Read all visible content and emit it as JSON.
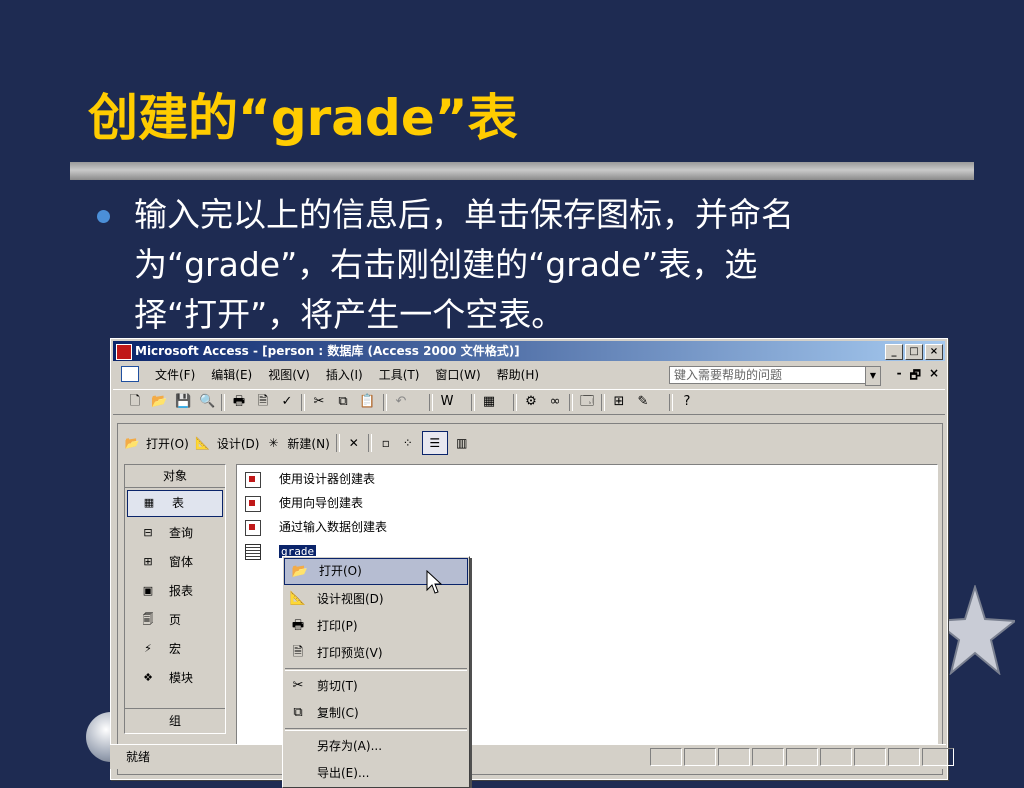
{
  "slide": {
    "title": "创建的“grade”表",
    "bullet_lines": [
      "输入完以上的信息后，单击保存图标，并命名",
      "为“grade”，右击刚创建的“grade”表，选",
      "择“打开”，将产生一个空表。"
    ]
  },
  "window": {
    "title": "Microsoft Access - [person : 数据库 (Access 2000 文件格式)]",
    "buttons": {
      "minimize": "_",
      "restore": "□",
      "close": "×"
    }
  },
  "menubar": {
    "items": [
      "文件(F)",
      "编辑(E)",
      "视图(V)",
      "插入(I)",
      "工具(T)",
      "窗口(W)",
      "帮助(H)"
    ],
    "help_placeholder": "键入需要帮助的问题",
    "mdi": [
      "-",
      "🗗",
      "×"
    ]
  },
  "db_toolbar": {
    "open": "打开(O)",
    "design": "设计(D)",
    "new": "新建(N)",
    "delete_icon": "✕"
  },
  "objects": {
    "header": "对象",
    "items": [
      "表",
      "查询",
      "窗体",
      "报表",
      "页",
      "宏",
      "模块"
    ],
    "selected": "表",
    "groups": "组"
  },
  "list": {
    "items": [
      "使用设计器创建表",
      "使用向导创建表",
      "通过输入数据创建表"
    ],
    "table_name": "grade"
  },
  "context_menu": {
    "items": [
      "打开(O)",
      "设计视图(D)",
      "打印(P)",
      "打印预览(V)",
      "剪切(T)",
      "复制(C)",
      "另存为(A)...",
      "导出(E)..."
    ],
    "highlighted": "打开(O)"
  },
  "status": {
    "text": "就绪"
  },
  "colors": {
    "slide_bg": "#1e2b52",
    "title": "#ffcc00",
    "titlebar": "#0a246a"
  }
}
